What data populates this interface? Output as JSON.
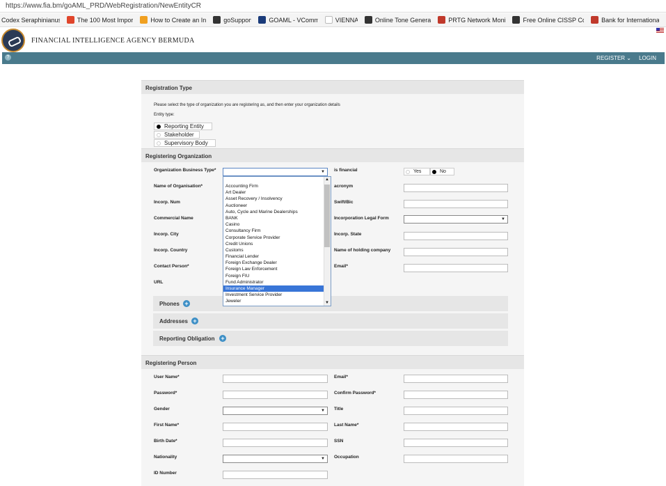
{
  "browser": {
    "url": "https://www.fia.bm/goAML_PRD/WebRegistration/NewEntityCR",
    "bookmarks": [
      {
        "icon": "page-icon",
        "label": "Codex Seraphinianus",
        "color": ""
      },
      {
        "icon": "bf-icon",
        "label": "The 100 Most Import",
        "color": "#e0452b"
      },
      {
        "icon": "star-icon",
        "label": "How to Create an Int",
        "color": "#f0a020"
      },
      {
        "icon": "gosupport-icon",
        "label": "goSupport",
        "color": "#333"
      },
      {
        "icon": "goaml-icon",
        "label": "GOAML - VComm",
        "color": "#1a3b7a"
      },
      {
        "icon": "page-icon",
        "label": "VIENNA",
        "color": ""
      },
      {
        "icon": "wave-icon",
        "label": "Online Tone Generat",
        "color": "#333"
      },
      {
        "icon": "prtg-icon",
        "label": "PRTG Network Monit",
        "color": "#c0392b"
      },
      {
        "icon": "download-icon",
        "label": "Free Online CISSP Co",
        "color": "#333"
      },
      {
        "icon": "bank-icon",
        "label": "Bank for International",
        "color": "#c0392b"
      }
    ]
  },
  "header": {
    "agency": "FINANCIAL INTELLIGENCE AGENCY BERMUDA"
  },
  "nav": {
    "help": "?",
    "register": "REGISTER ⌄",
    "login": "LOGIN"
  },
  "registration_type": {
    "title": "Registration Type",
    "note": "Please select the type of organization you are registering as, and then enter your organization details",
    "entity_type_label": "Entity type:",
    "options": [
      "Reporting Entity",
      "Stakeholder",
      "Supervisory Body"
    ],
    "selected": "Reporting Entity"
  },
  "registering_org": {
    "title": "Registering Organization",
    "business_type_label": "Organization Business Type*",
    "is_financial_label": "is financial",
    "yes": "Yes",
    "no": "No",
    "name_label": "Name of Organisation*",
    "acronym_label": "acronym",
    "incorp_num_label": "Incorp. Num",
    "swift_label": "Swift/Bic",
    "commercial_name_label": "Commercial Name",
    "legal_form_label": "Incorporation Legal Form",
    "incorp_city_label": "Incorp. City",
    "incorp_state_label": "Incorp. State",
    "incorp_country_label": "Incorp. Country",
    "holding_label": "Name of holding company",
    "contact_label": "Contact Person*",
    "email_label": "Email*",
    "url_label": "URL",
    "phones": "Phones",
    "addresses": "Addresses",
    "reporting_obligation": "Reporting Obligation"
  },
  "business_type_options": [
    "Accounting Firm",
    "Art Dealer",
    "Asset Recovery / Insolvency",
    "Auctioneer",
    "Auto, Cycle and Marine Dealerships",
    "BANK",
    "Casino",
    "Consultancy Firm",
    "Corporate Service Provider",
    "Credit Unions",
    "Customs",
    "Financial Lender",
    "Foreign Exchange Dealer",
    "Foreign Law Enforcement",
    "Foreign FIU",
    "Fund Administrator",
    "Insurance Manager",
    "Investment Service Provider",
    "Jeweler"
  ],
  "highlighted_option": "Insurance Manager",
  "registering_person": {
    "title": "Registering Person",
    "username_label": "User Name*",
    "email_label": "Email*",
    "password_label": "Password*",
    "confirm_label": "Confirm Password*",
    "gender_label": "Gender",
    "title_label": "Title",
    "first_label": "First Name*",
    "last_label": "Last Name*",
    "birth_label": "Birth Date*",
    "ssn_label": "SSN",
    "nationality_label": "Nationality",
    "occupation_label": "Occupation",
    "id_label": "ID Number"
  }
}
